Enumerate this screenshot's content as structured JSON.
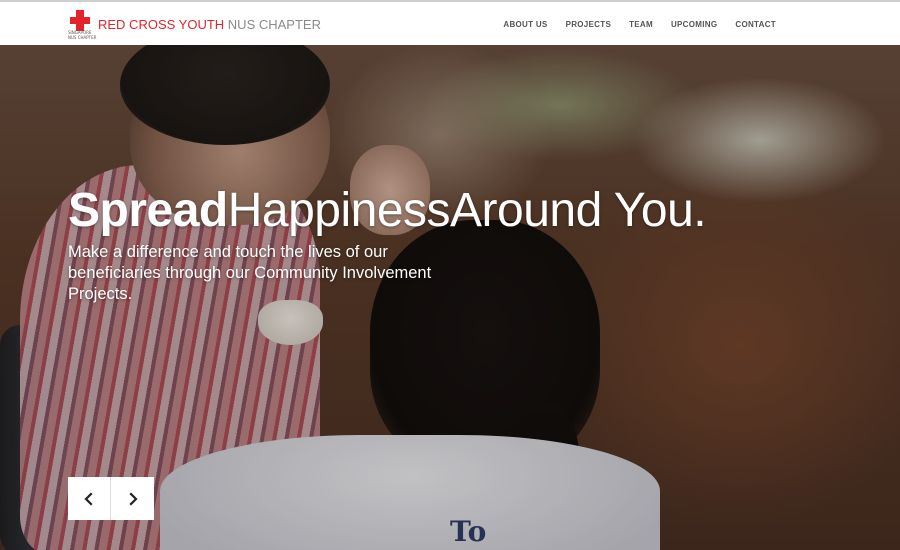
{
  "brand": {
    "logo_caption": "SINGAPORE\nNUS CHAPTER",
    "name_red": "RED CROSS YOUTH",
    "name_grey": "NUS CHAPTER"
  },
  "nav": {
    "items": [
      "ABOUT US",
      "PROJECTS",
      "TEAM",
      "UPCOMING",
      "CONTACT"
    ]
  },
  "hero": {
    "headline_bold": "Spread",
    "headline_light": "HappinessAround You.",
    "subtext": "Make a difference and touch the lives of our beneficiaries through our Community Involvement Projects.",
    "shirt_print": "To"
  },
  "carousel": {
    "prev_icon": "chevron-left-icon",
    "next_icon": "chevron-right-icon"
  },
  "colors": {
    "brand_red": "#e3242b",
    "nav_text": "#555555",
    "navbar_bg": "#ffffff"
  }
}
